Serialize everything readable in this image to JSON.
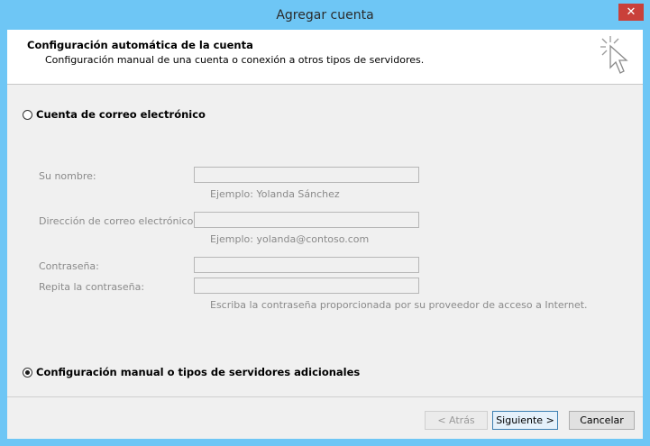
{
  "window": {
    "title": "Agregar cuenta",
    "close_glyph": "✕"
  },
  "header": {
    "title": "Configuración automática de la cuenta",
    "subtitle": "Configuración manual de una cuenta o conexión a otros tipos de servidores.",
    "icon": "cursor-sparkle-icon"
  },
  "options": {
    "email_account": {
      "label": "Cuenta de correo electrónico",
      "selected": false
    },
    "manual_config": {
      "label": "Configuración manual o tipos de servidores adicionales",
      "selected": true
    }
  },
  "form": {
    "name": {
      "label": "Su nombre:",
      "value": "",
      "hint": "Ejemplo: Yolanda Sánchez"
    },
    "email": {
      "label": "Dirección de correo electrónico:",
      "value": "",
      "hint": "Ejemplo: yolanda@contoso.com"
    },
    "password": {
      "label": "Contraseña:",
      "value": ""
    },
    "password_repeat": {
      "label": "Repita la contraseña:",
      "value": ""
    },
    "password_hint": "Escriba la contraseña proporcionada por su proveedor de acceso a Internet."
  },
  "buttons": {
    "back": "< Atrás",
    "next": "Siguiente >",
    "cancel": "Cancelar"
  },
  "colors": {
    "titlebar": "#6ec6f5",
    "close": "#c9403a"
  }
}
